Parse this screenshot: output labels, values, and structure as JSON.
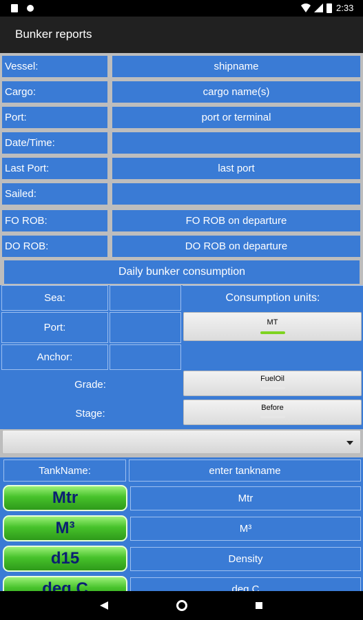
{
  "status": {
    "time": "2:33"
  },
  "app": {
    "title": "Bunker reports"
  },
  "fields": [
    {
      "label": "Vessel:",
      "value": "shipname"
    },
    {
      "label": "Cargo:",
      "value": "cargo name(s)"
    },
    {
      "label": "Port:",
      "value": "port or terminal"
    },
    {
      "label": "Date/Time:",
      "value": ""
    },
    {
      "label": "Last Port:",
      "value": "last port"
    },
    {
      "label": "Sailed:",
      "value": ""
    },
    {
      "label": "FO ROB:",
      "value": "FO ROB on departure"
    },
    {
      "label": "DO ROB:",
      "value": "DO ROB on departure"
    }
  ],
  "daily": {
    "title": "Daily bunker consumption",
    "sea_label": "Sea:",
    "port_label": "Port:",
    "anchor_label": "Anchor:",
    "units_label": "Consumption units:",
    "units_value": "MT",
    "grade_label": "Grade:",
    "grade_value": "FuelOil",
    "stage_label": "Stage:",
    "stage_value": "Before"
  },
  "dropdown": {
    "value": ""
  },
  "tank": {
    "label": "TankName:",
    "value": "enter tankname",
    "rows": [
      {
        "button": "Mtr",
        "value": "Mtr"
      },
      {
        "button": "M³",
        "value": "M³"
      },
      {
        "button": "d15",
        "value": "Density"
      },
      {
        "button": "deg C",
        "value": "deg C"
      }
    ]
  },
  "colors": {
    "cell": "#3a7bd5",
    "background": "#bdbdbd",
    "on_indicator": "#7ed321"
  }
}
